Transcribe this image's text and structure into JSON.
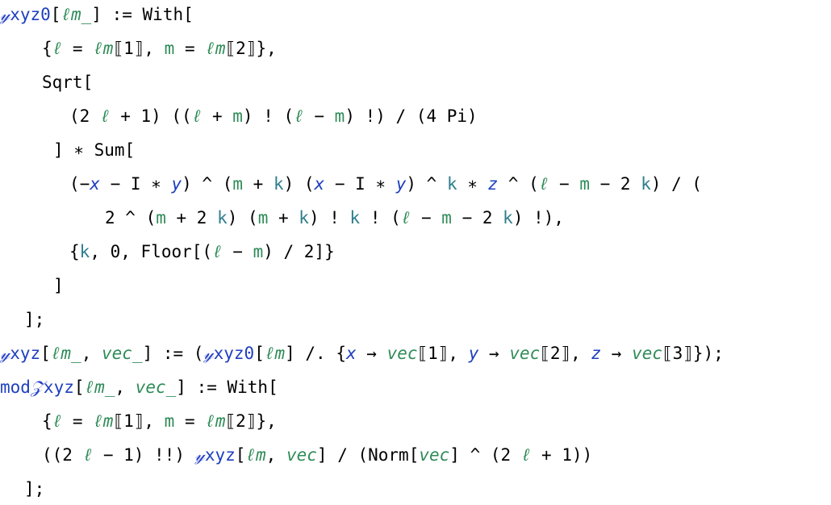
{
  "lines": [
    [
      {
        "t": "𝓎",
        "c": "sy"
      },
      {
        "t": "xyz0",
        "c": "b"
      },
      {
        "t": "["
      },
      {
        "t": "ℓm_",
        "c": "gi"
      },
      {
        "t": "] := With["
      }
    ],
    [
      {
        "t": "{"
      },
      {
        "t": "ℓ",
        "c": "gi"
      },
      {
        "t": " = "
      },
      {
        "t": "ℓm",
        "c": "gi"
      },
      {
        "t": "⟦1⟧, "
      },
      {
        "t": "m",
        "c": "g"
      },
      {
        "t": " = "
      },
      {
        "t": "ℓm",
        "c": "gi"
      },
      {
        "t": "⟦2⟧},"
      }
    ],
    [
      {
        "t": "Sqrt["
      }
    ],
    [
      {
        "t": "(2 "
      },
      {
        "t": "ℓ",
        "c": "gi"
      },
      {
        "t": " + 1) (("
      },
      {
        "t": "ℓ",
        "c": "gi"
      },
      {
        "t": " + "
      },
      {
        "t": "m",
        "c": "g"
      },
      {
        "t": ") ! ("
      },
      {
        "t": "ℓ",
        "c": "gi"
      },
      {
        "t": " − "
      },
      {
        "t": "m",
        "c": "g"
      },
      {
        "t": ") !) / (4 Pi)"
      }
    ],
    [
      {
        "t": "] ∗ Sum["
      }
    ],
    [
      {
        "t": "(−"
      },
      {
        "t": "x",
        "c": "bi"
      },
      {
        "t": " − I ∗ "
      },
      {
        "t": "y",
        "c": "bi"
      },
      {
        "t": ") ^ ("
      },
      {
        "t": "m",
        "c": "g"
      },
      {
        "t": " + "
      },
      {
        "t": "k",
        "c": "t2"
      },
      {
        "t": ") ("
      },
      {
        "t": "x",
        "c": "bi"
      },
      {
        "t": " − I ∗ "
      },
      {
        "t": "y",
        "c": "bi"
      },
      {
        "t": ") ^ "
      },
      {
        "t": "k",
        "c": "t2"
      },
      {
        "t": " ∗ "
      },
      {
        "t": "z",
        "c": "bi"
      },
      {
        "t": " ^ ("
      },
      {
        "t": "ℓ",
        "c": "gi"
      },
      {
        "t": " − "
      },
      {
        "t": "m",
        "c": "g"
      },
      {
        "t": " − 2 "
      },
      {
        "t": "k",
        "c": "t2"
      },
      {
        "t": ") / ("
      }
    ],
    [
      {
        "t": "2 ^ ("
      },
      {
        "t": "m",
        "c": "g"
      },
      {
        "t": " + 2 "
      },
      {
        "t": "k",
        "c": "t2"
      },
      {
        "t": ") ("
      },
      {
        "t": "m",
        "c": "g"
      },
      {
        "t": " + "
      },
      {
        "t": "k",
        "c": "t2"
      },
      {
        "t": ") ! "
      },
      {
        "t": "k",
        "c": "t2"
      },
      {
        "t": " ! ("
      },
      {
        "t": "ℓ",
        "c": "gi"
      },
      {
        "t": " − "
      },
      {
        "t": "m",
        "c": "g"
      },
      {
        "t": " − 2 "
      },
      {
        "t": "k",
        "c": "t2"
      },
      {
        "t": ") !),"
      }
    ],
    [
      {
        "t": "{"
      },
      {
        "t": "k",
        "c": "t2"
      },
      {
        "t": ", 0, Floor[("
      },
      {
        "t": "ℓ",
        "c": "gi"
      },
      {
        "t": " − "
      },
      {
        "t": "m",
        "c": "g"
      },
      {
        "t": ") / 2]}"
      }
    ],
    [
      {
        "t": "]"
      }
    ],
    [
      {
        "t": "];"
      }
    ],
    [
      {
        "t": "𝓎",
        "c": "sy"
      },
      {
        "t": "xyz",
        "c": "b"
      },
      {
        "t": "["
      },
      {
        "t": "ℓm_",
        "c": "gi"
      },
      {
        "t": ", "
      },
      {
        "t": "vec_",
        "c": "gi"
      },
      {
        "t": "] := ("
      },
      {
        "t": "𝓎",
        "c": "sy"
      },
      {
        "t": "xyz0",
        "c": "b"
      },
      {
        "t": "["
      },
      {
        "t": "ℓm",
        "c": "gi"
      },
      {
        "t": "] /. {"
      },
      {
        "t": "x",
        "c": "bi"
      },
      {
        "t": " → "
      },
      {
        "t": "vec",
        "c": "gi"
      },
      {
        "t": "⟦1⟧, "
      },
      {
        "t": "y",
        "c": "bi"
      },
      {
        "t": " → "
      },
      {
        "t": "vec",
        "c": "gi"
      },
      {
        "t": "⟦2⟧, "
      },
      {
        "t": "z",
        "c": "bi"
      },
      {
        "t": " → "
      },
      {
        "t": "vec",
        "c": "gi"
      },
      {
        "t": "⟦3⟧});"
      }
    ],
    [
      {
        "t": "mod",
        "c": "b"
      },
      {
        "t": "𝒵",
        "c": "sy"
      },
      {
        "t": "xyz",
        "c": "b"
      },
      {
        "t": "["
      },
      {
        "t": "ℓm_",
        "c": "gi"
      },
      {
        "t": ", "
      },
      {
        "t": "vec_",
        "c": "gi"
      },
      {
        "t": "] := With["
      }
    ],
    [
      {
        "t": "{"
      },
      {
        "t": "ℓ",
        "c": "gi"
      },
      {
        "t": " = "
      },
      {
        "t": "ℓm",
        "c": "gi"
      },
      {
        "t": "⟦1⟧, "
      },
      {
        "t": "m",
        "c": "g"
      },
      {
        "t": " = "
      },
      {
        "t": "ℓm",
        "c": "gi"
      },
      {
        "t": "⟦2⟧},"
      }
    ],
    [
      {
        "t": "((2 "
      },
      {
        "t": "ℓ",
        "c": "gi"
      },
      {
        "t": " − 1) !!) "
      },
      {
        "t": "𝓎",
        "c": "sy"
      },
      {
        "t": "xyz",
        "c": "b"
      },
      {
        "t": "["
      },
      {
        "t": "ℓm",
        "c": "gi"
      },
      {
        "t": ", "
      },
      {
        "t": "vec",
        "c": "gi"
      },
      {
        "t": "] / (Norm["
      },
      {
        "t": "vec",
        "c": "gi"
      },
      {
        "t": "] ^ (2 "
      },
      {
        "t": "ℓ",
        "c": "gi"
      },
      {
        "t": " + 1))"
      }
    ],
    [
      {
        "t": "];"
      }
    ]
  ]
}
